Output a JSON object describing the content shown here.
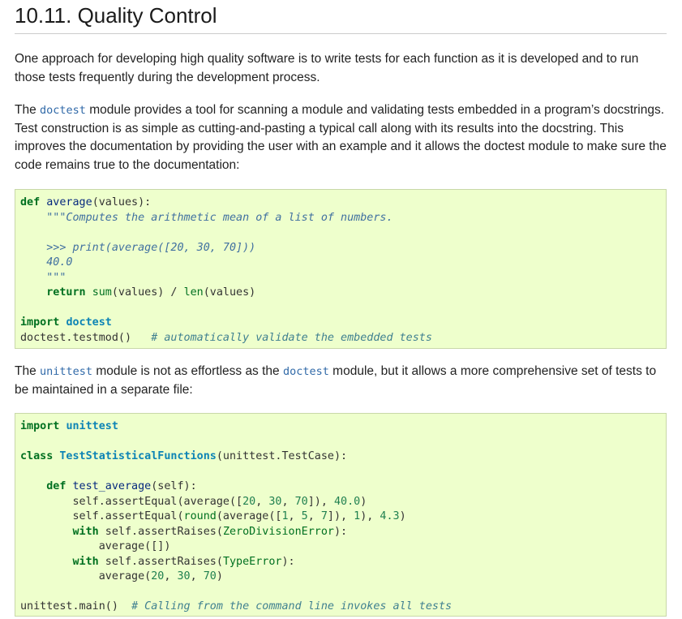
{
  "title": "10.11. Quality Control",
  "para1": "One approach for developing high quality software is to write tests for each function as it is developed and to run those tests frequently during the development process.",
  "para2": {
    "pre": "The ",
    "code1": "doctest",
    "post": " module provides a tool for scanning a module and validating tests embedded in a program’s docstrings. Test construction is as simple as cutting-and-pasting a typical call along with its results into the docstring. This improves the documentation by providing the user with an example and it allows the doctest module to make sure the code remains true to the documentation:"
  },
  "para3": {
    "pre": "The ",
    "code1": "unittest",
    "mid": " module is not as effortless as the ",
    "code2": "doctest",
    "post": " module, but it allows a more comprehensive set of tests to be maintained in a separate file:"
  },
  "code_block_1": [
    "def average(values):",
    "    \"\"\"Computes the arithmetic mean of a list of numbers.",
    "",
    "    >>> print(average([20, 30, 70]))",
    "    40.0",
    "    \"\"\"",
    "    return sum(values) / len(values)",
    "",
    "import doctest",
    "doctest.testmod()   # automatically validate the embedded tests"
  ],
  "code_block_2": [
    "import unittest",
    "",
    "class TestStatisticalFunctions(unittest.TestCase):",
    "",
    "    def test_average(self):",
    "        self.assertEqual(average([20, 30, 70]), 40.0)",
    "        self.assertEqual(round(average([1, 5, 7]), 1), 4.3)",
    "        with self.assertRaises(ZeroDivisionError):",
    "            average([])",
    "        with self.assertRaises(TypeError):",
    "            average(20, 30, 70)",
    "",
    "unittest.main()  # Calling from the command line invokes all tests"
  ],
  "colors": {
    "code_background": "#eeffcc",
    "inline_code": "#3069a8",
    "keyword": "#007020",
    "docstring": "#4070a0",
    "comment": "#408090"
  }
}
